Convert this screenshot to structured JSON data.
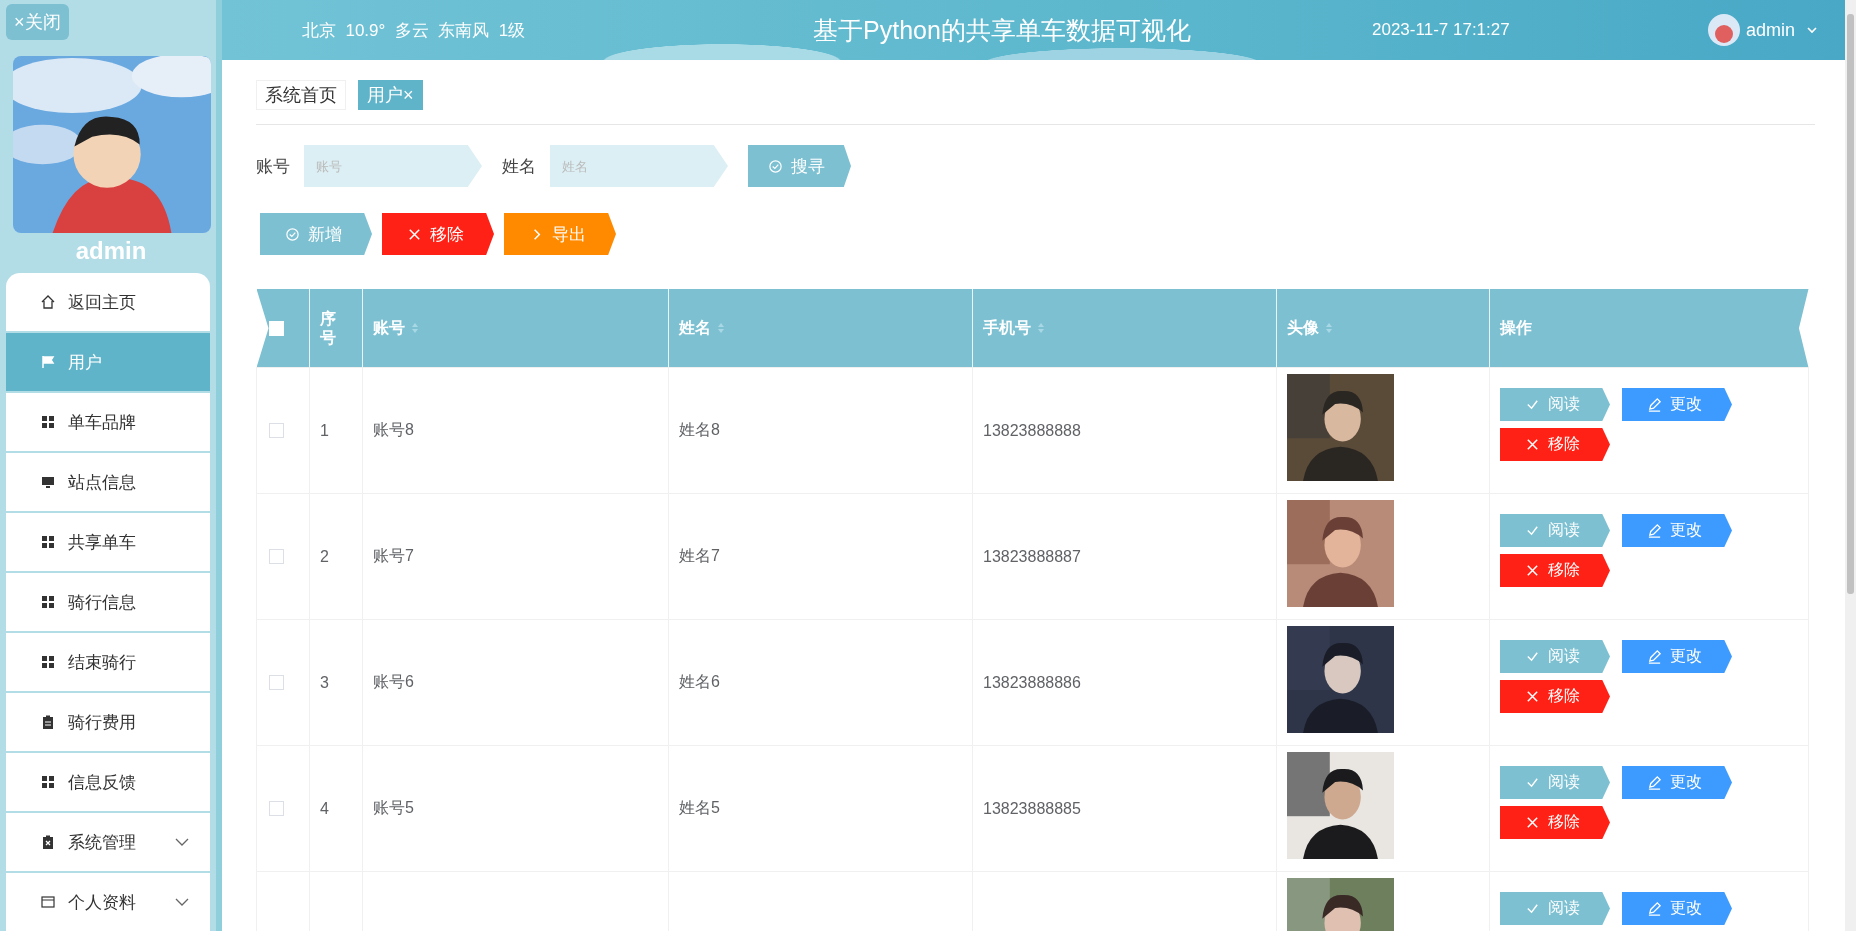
{
  "sidebar": {
    "close_button": "×关闭",
    "username": "admin",
    "items": [
      {
        "label": "返回主页",
        "selected": false
      },
      {
        "label": "用户",
        "selected": true
      },
      {
        "label": "单车品牌",
        "selected": false
      },
      {
        "label": "站点信息",
        "selected": false
      },
      {
        "label": "共享单车",
        "selected": false
      },
      {
        "label": "骑行信息",
        "selected": false
      },
      {
        "label": "结束骑行",
        "selected": false
      },
      {
        "label": "骑行费用",
        "selected": false
      },
      {
        "label": "信息反馈",
        "selected": false
      },
      {
        "label": "系统管理",
        "selected": false,
        "expanded": false
      },
      {
        "label": "个人资料",
        "selected": false,
        "expanded": false
      }
    ]
  },
  "header": {
    "weather": "北京  10.9°  多云  东南风  1级",
    "title": "基于Python的共享单车数据可视化",
    "datetime": "2023-11-7 17:1:27",
    "user": "admin"
  },
  "tabs": [
    {
      "label": "系统首页",
      "selected": false
    },
    {
      "label": "用户",
      "close": "×",
      "selected": true
    }
  ],
  "search": {
    "fields": [
      {
        "label": "账号",
        "placeholder": "账号"
      },
      {
        "label": "姓名",
        "placeholder": "姓名"
      }
    ],
    "button": {
      "label": "搜寻",
      "kind": "search"
    }
  },
  "toolbar": [
    {
      "label": "新增",
      "kind": "add"
    },
    {
      "label": "移除",
      "kind": "delete"
    },
    {
      "label": "导出",
      "kind": "export"
    }
  ],
  "table": {
    "select_all": {
      "checked": false
    },
    "columns": [
      {
        "label": "序号",
        "sortable": false
      },
      {
        "label": "账号",
        "sortable": true
      },
      {
        "label": "姓名",
        "sortable": true
      },
      {
        "label": "手机号",
        "sortable": true
      },
      {
        "label": "头像",
        "sortable": true
      },
      {
        "label": "操作",
        "sortable": false
      }
    ],
    "rows": [
      {
        "checked": false,
        "index": "1",
        "account": "账号8",
        "name": "姓名8",
        "phone": "13823888888",
        "avatar": {
          "kind": "picture"
        },
        "actions": [
          {
            "label": "阅读",
            "kind": "view"
          },
          {
            "label": "更改",
            "kind": "edit"
          },
          {
            "label": "移除",
            "kind": "delete"
          }
        ]
      },
      {
        "checked": false,
        "index": "2",
        "account": "账号7",
        "name": "姓名7",
        "phone": "13823888887",
        "avatar": {
          "kind": "picture"
        },
        "actions": [
          {
            "label": "阅读",
            "kind": "view"
          },
          {
            "label": "更改",
            "kind": "edit"
          },
          {
            "label": "移除",
            "kind": "delete"
          }
        ]
      },
      {
        "checked": false,
        "index": "3",
        "account": "账号6",
        "name": "姓名6",
        "phone": "13823888886",
        "avatar": {
          "kind": "picture"
        },
        "actions": [
          {
            "label": "阅读",
            "kind": "view"
          },
          {
            "label": "更改",
            "kind": "edit"
          },
          {
            "label": "移除",
            "kind": "delete"
          }
        ]
      },
      {
        "checked": false,
        "index": "4",
        "account": "账号5",
        "name": "姓名5",
        "phone": "13823888885",
        "avatar": {
          "kind": "picture"
        },
        "actions": [
          {
            "label": "阅读",
            "kind": "view"
          },
          {
            "label": "更改",
            "kind": "edit"
          },
          {
            "label": "移除",
            "kind": "delete"
          }
        ]
      },
      {
        "avatar": {
          "kind": "picture"
        },
        "actions": [
          {
            "label": "阅读",
            "kind": "view"
          },
          {
            "label": "更改",
            "kind": "edit"
          }
        ]
      }
    ]
  }
}
